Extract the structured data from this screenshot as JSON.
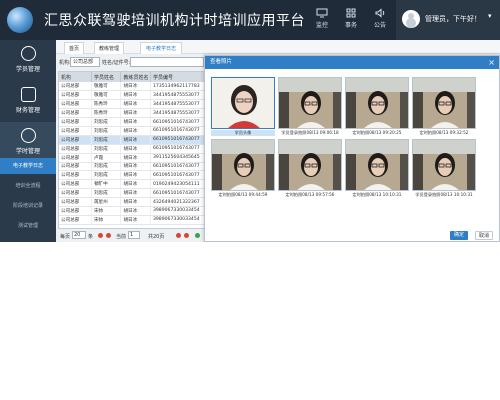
{
  "app": {
    "title": "汇思众联驾驶培训机构计时培训应用平台"
  },
  "header": {
    "nav": [
      {
        "label": "监控",
        "icon": "monitor-icon"
      },
      {
        "label": "事务",
        "icon": "grid-icon"
      },
      {
        "label": "公告",
        "icon": "speaker-icon"
      }
    ],
    "user": {
      "greeting": "管理员，下午好！",
      "icon": "user-avatar-icon"
    }
  },
  "sidebar": {
    "modules": [
      {
        "label": "学员管理",
        "icon": "user-icon"
      },
      {
        "label": "财务管理",
        "icon": "finance-icon"
      },
      {
        "label": "学时管理",
        "icon": "clock-icon"
      }
    ],
    "sub_items": [
      "电子教学日志",
      "培训全流程",
      "阶段培训记录",
      "测试管理"
    ]
  },
  "tabs": [
    "首页",
    "教练管理",
    "电子教学日志"
  ],
  "filter": {
    "org_label": "机构:",
    "org_value": "公司总部",
    "name_label": "姓名/证件号:",
    "name_value": "",
    "extra_label": "有效"
  },
  "grid": {
    "columns": [
      "机构",
      "学员姓名",
      "教练员姓名",
      "学员编号"
    ],
    "rows": [
      [
        "公司总部",
        "敬雅可",
        "胡日冰",
        "1735134962117783"
      ],
      [
        "公司总部",
        "敬雅可",
        "胡日冰",
        "3441954875553077"
      ],
      [
        "公司总部",
        "陈秀玲",
        "胡日冰",
        "3441954875553077"
      ],
      [
        "公司总部",
        "陈秀玲",
        "胡日冰",
        "3441954875553077"
      ],
      [
        "公司总部",
        "刘思成",
        "胡日冰",
        "6610951016743077"
      ],
      [
        "公司总部",
        "刘思成",
        "胡日冰",
        "6610951016743077"
      ],
      [
        "公司总部",
        "刘思成",
        "胡日冰",
        "6610951016743077"
      ],
      [
        "公司总部",
        "刘思成",
        "胡日冰",
        "6610951016743077"
      ],
      [
        "公司总部",
        "卢霞",
        "胡日冰",
        "3911525604345645"
      ],
      [
        "公司总部",
        "刘思成",
        "胡日冰",
        "6610951016743077"
      ],
      [
        "公司总部",
        "刘思成",
        "胡日冰",
        "6610951016743077"
      ],
      [
        "公司总部",
        "頓旷中",
        "胡日冰",
        "0190249423054111"
      ],
      [
        "公司总部",
        "刘思成",
        "胡日冰",
        "6610951016743077"
      ],
      [
        "公司总部",
        "苒星州",
        "胡日冰",
        "4326494021322367"
      ],
      [
        "公司总部",
        "宋帅",
        "胡日冰",
        "3989067330033454"
      ],
      [
        "公司总部",
        "宋帅",
        "胡日冰",
        "3989067330033454"
      ]
    ],
    "selected_row": 6
  },
  "pager": {
    "per_page_label": "每页",
    "per_page": "20",
    "per_page_unit": "条",
    "page_label": "当前",
    "page": "1",
    "total_label": "共20页",
    "total_pages_unit": "页"
  },
  "modal": {
    "title": "查看照片",
    "close": "×",
    "photos": [
      {
        "caption": "学员头像",
        "selected": true,
        "scene": "portrait"
      },
      {
        "caption": "学员登录拍照08/13 09:06:18",
        "selected": false,
        "scene": "car"
      },
      {
        "caption": "定时拍照08/13 09:20:25",
        "selected": false,
        "scene": "car"
      },
      {
        "caption": "定时拍照08/13 09:32:52",
        "selected": false,
        "scene": "car"
      },
      {
        "caption": "定时拍照08/13 09:44:59",
        "selected": false,
        "scene": "car"
      },
      {
        "caption": "定时拍照08/13 09:57:56",
        "selected": false,
        "scene": "car"
      },
      {
        "caption": "定时拍照08/13 10:10:31",
        "selected": false,
        "scene": "car"
      },
      {
        "caption": "学员登录拍照08/13 10:10:31",
        "selected": false,
        "scene": "car"
      }
    ],
    "ok_label": "确定",
    "cancel_label": "取消"
  },
  "colors": {
    "header_bg": "#1f2b38",
    "sidebar_bg": "#2a3a4b",
    "accent": "#2f7ec6",
    "pager_dot": "#d7443b"
  }
}
